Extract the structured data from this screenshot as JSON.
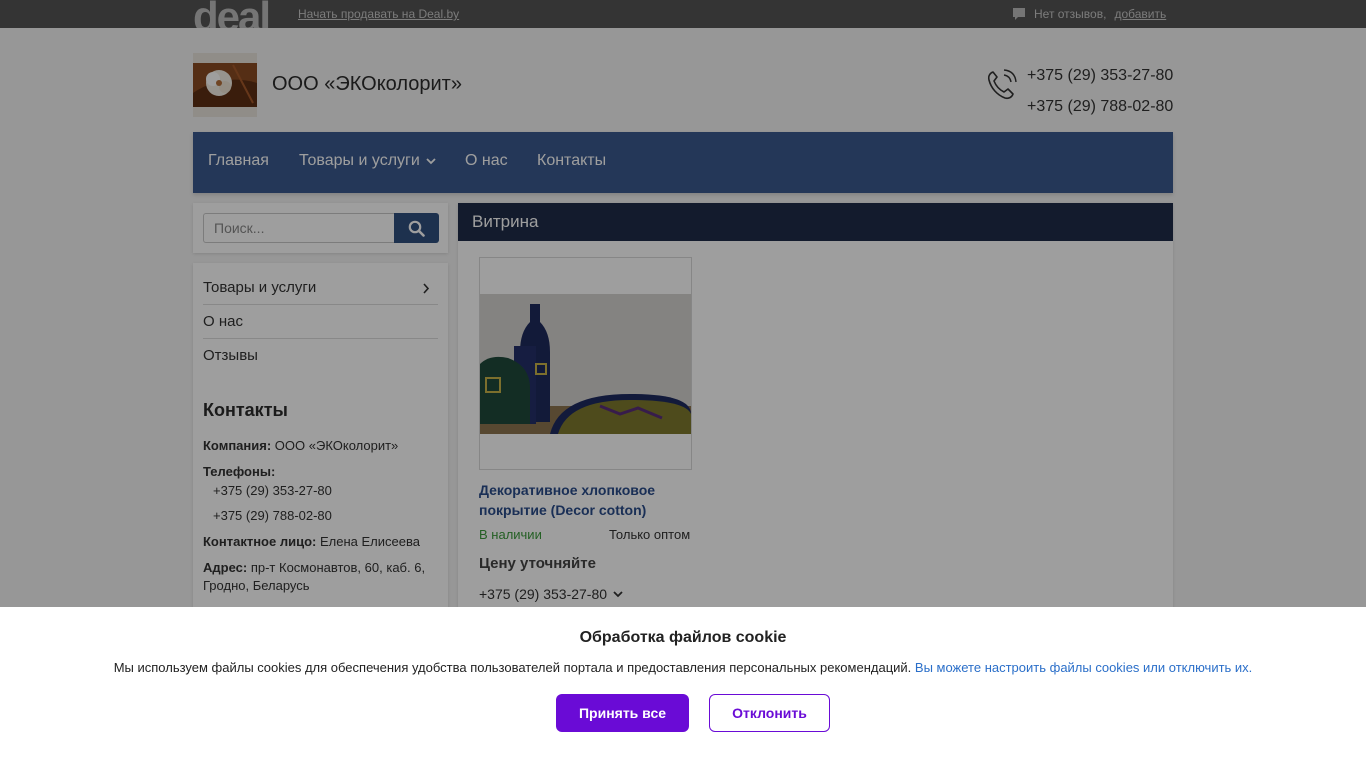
{
  "topbar": {
    "logo": "deal",
    "start_selling": "Начать продавать на Deal.by",
    "reviews_none": "Нет отзывов,",
    "reviews_add": "добавить"
  },
  "header": {
    "company_name": "ООО «ЭКОколорит»",
    "phones": [
      "+375 (29) 353-27-80",
      "+375 (29) 788-02-80"
    ]
  },
  "nav": {
    "items": [
      {
        "label": "Главная"
      },
      {
        "label": "Товары и услуги",
        "has_dropdown": true
      },
      {
        "label": "О нас"
      },
      {
        "label": "Контакты"
      }
    ]
  },
  "search": {
    "placeholder": "Поиск..."
  },
  "sidebar": {
    "links": [
      {
        "label": "Товары и услуги"
      },
      {
        "label": "О нас"
      },
      {
        "label": "Отзывы"
      }
    ],
    "contacts_title": "Контакты",
    "company_label": "Компания:",
    "company_value": "ООО «ЭКОколорит»",
    "phones_label": "Телефоны:",
    "phones": [
      "+375 (29) 353-27-80",
      "+375 (29) 788-02-80"
    ],
    "contact_person_label": "Контактное лицо:",
    "contact_person_value": "Елена Елисеева",
    "address_label": "Адрес:",
    "address_value": "пр-т Космонавтов, 60, каб. 6, Гродно, Беларусь"
  },
  "showcase": {
    "title": "Витрина",
    "product": {
      "title": "Декоративное хлопковое покрытие (Decor cotton)",
      "stock": "В наличии",
      "sale_type": "Только оптом",
      "price": "Цену уточняйте",
      "phone": "+375 (29) 353-27-80"
    }
  },
  "cookie": {
    "title": "Обработка файлов cookie",
    "text": "Мы используем файлы cookies для обеспечения удобства пользователей портала и предоставления персональных рекомендаций.",
    "link": "Вы можете настроить файлы cookies или отключить их.",
    "accept": "Принять все",
    "decline": "Отклонить"
  },
  "colors": {
    "nav_bg": "#3b5a8f",
    "showcase_head_bg": "#1f2d4a",
    "accent_purple": "#6a0bd6",
    "link_blue": "#2b6fc9",
    "in_stock_green": "#3a9a3a"
  }
}
